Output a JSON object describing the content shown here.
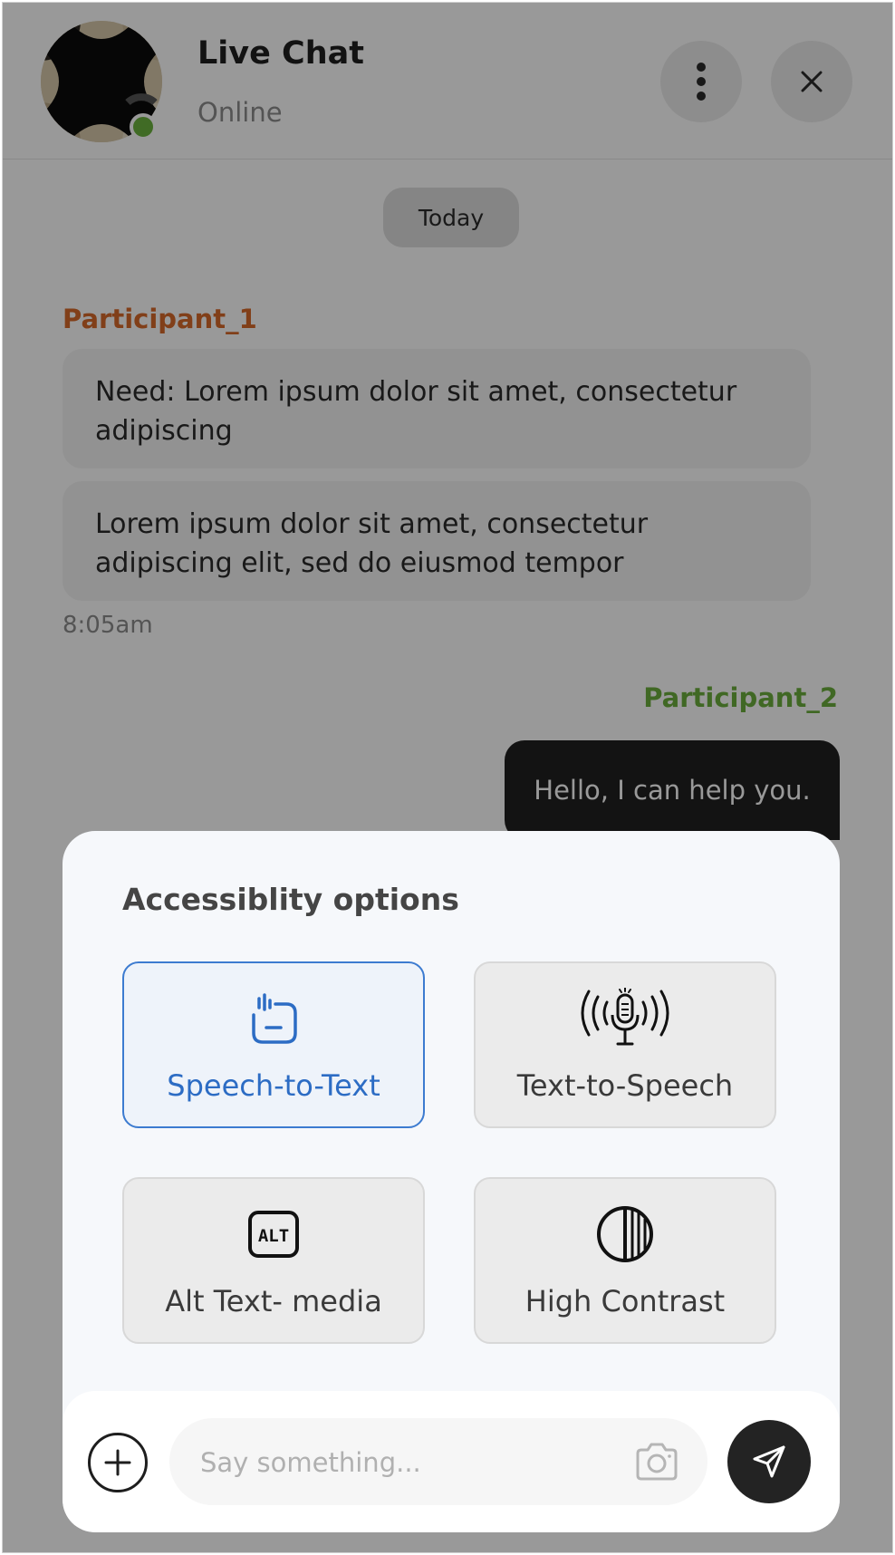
{
  "header": {
    "title": "Live Chat",
    "status": "Online",
    "status_color": "#6cb33f"
  },
  "chat": {
    "date_label": "Today",
    "participant_1": {
      "name": "Participant_1",
      "color": "#d86a2a",
      "messages": [
        "Need: Lorem ipsum dolor sit amet, consectetur adipiscing",
        "Lorem ipsum dolor sit amet, consectetur adipiscing elit, sed do eiusmod tempor"
      ],
      "time": "8:05am"
    },
    "participant_2": {
      "name": "Participant_2",
      "color": "#6cae3c",
      "messages": [
        "Hello, I can help you."
      ]
    }
  },
  "accessibility": {
    "title": "Accessiblity options",
    "options": [
      {
        "label": "Speech-to-Text",
        "icon": "speech-to-text-icon",
        "selected": true
      },
      {
        "label": "Text-to-Speech",
        "icon": "microphone-broadcast-icon",
        "selected": false
      },
      {
        "label": "Alt Text- media",
        "icon": "alt-text-icon",
        "selected": false
      },
      {
        "label": "High Contrast",
        "icon": "contrast-icon",
        "selected": false
      }
    ],
    "accent_color": "#2c6cc4"
  },
  "composer": {
    "placeholder": "Say something...",
    "add_icon": "plus-icon",
    "camera_icon": "camera-icon",
    "send_icon": "send-icon"
  }
}
